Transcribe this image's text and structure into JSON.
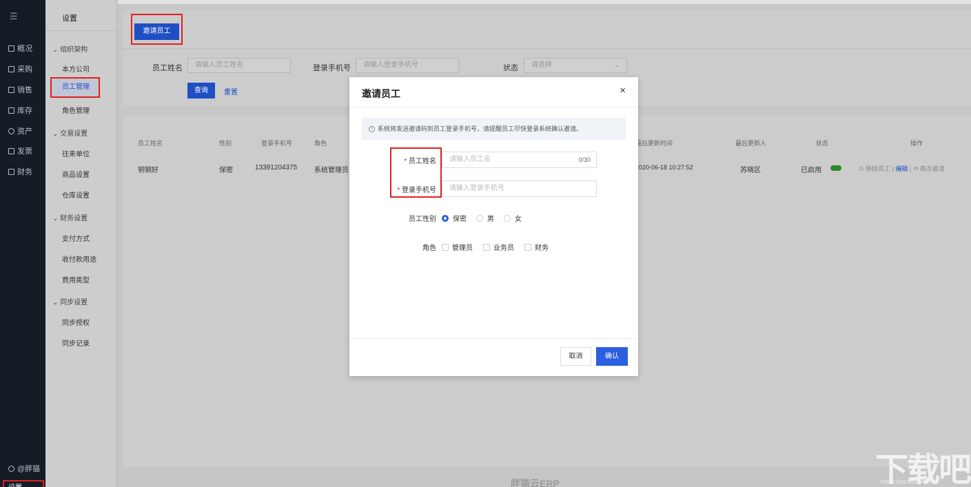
{
  "sidebar": {
    "menu_icon": "☰",
    "items": [
      {
        "label": "概况",
        "icon": "dashboard-icon"
      },
      {
        "label": "采购",
        "icon": "purchase-icon"
      },
      {
        "label": "销售",
        "icon": "sales-icon"
      },
      {
        "label": "库存",
        "icon": "inventory-icon"
      },
      {
        "label": "资产",
        "icon": "asset-icon"
      },
      {
        "label": "发票",
        "icon": "invoice-icon"
      },
      {
        "label": "财务",
        "icon": "finance-icon"
      }
    ],
    "user": "@胖猫",
    "settings": "设置"
  },
  "subnav": {
    "title": "设置",
    "groups": [
      {
        "label": "组织架构",
        "items": [
          "本方公司",
          "员工管理",
          "角色管理"
        ]
      },
      {
        "label": "交易设置",
        "items": [
          "往来单位",
          "商品设置",
          "仓库设置"
        ]
      },
      {
        "label": "财务设置",
        "items": [
          "支付方式",
          "收付款用途",
          "费用类型"
        ]
      },
      {
        "label": "同步设置",
        "items": [
          "同步授权",
          "同步记录"
        ]
      }
    ],
    "active": "员工管理"
  },
  "toolbar": {
    "invite_label": "邀请员工"
  },
  "filters": {
    "name_label": "员工姓名",
    "name_placeholder": "请输入员工姓名",
    "phone_label": "登录手机号",
    "phone_placeholder": "请输入登录手机号",
    "status_label": "状态",
    "status_placeholder": "请选择",
    "query_label": "查询",
    "reset_label": "重置"
  },
  "table": {
    "headers": [
      "员工姓名",
      "性别",
      "登录手机号",
      "角色",
      "最后更新时间",
      "最后更新人",
      "状态",
      "操作"
    ],
    "row": {
      "name": "铜钢好",
      "gender": "保密",
      "phone": "13391204375",
      "role": "系统管理员",
      "updated_at": "2020-06-18 10:27:52",
      "updated_by": "苏晓区",
      "status": "已启用",
      "op_remove": "⊙ 移除员工",
      "op_edit": "编辑",
      "op_reinvite": "⟲ 再次邀请"
    }
  },
  "modal": {
    "title": "邀请员工",
    "close": "×",
    "notice": "系统将发送邀请码到员工登录手机号，请提醒员工尽快登录系统确认邀请。",
    "name_label": "员工姓名",
    "name_placeholder": "请输入员工名",
    "name_count": "0/30",
    "phone_label": "登录手机号",
    "phone_placeholder": "请输入登录手机号",
    "gender_label": "员工性别",
    "gender_options": [
      "保密",
      "男",
      "女"
    ],
    "gender_selected": "保密",
    "role_label": "角色",
    "role_options": [
      "管理员",
      "业务员",
      "财务"
    ],
    "cancel": "取消",
    "confirm": "确认"
  },
  "footer": {
    "brand": "胖猫云ERP"
  },
  "watermark": {
    "text": "下载吧",
    "url": "www.xiazaiba.com"
  },
  "colors": {
    "primary": "#2b5fe0",
    "highlight": "#e02020",
    "sidebar_bg": "#151c26"
  }
}
